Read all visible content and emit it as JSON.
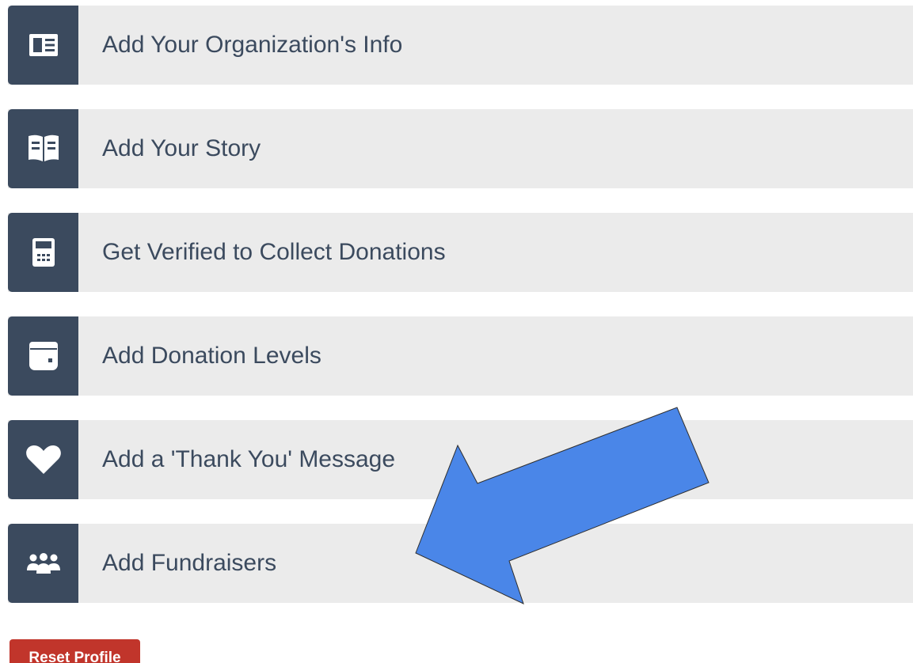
{
  "steps": [
    {
      "label": "Add Your Organization's Info",
      "icon": "id-card-icon"
    },
    {
      "label": "Add Your Story",
      "icon": "open-book-icon"
    },
    {
      "label": "Get Verified to Collect Donations",
      "icon": "calculator-icon"
    },
    {
      "label": "Add Donation Levels",
      "icon": "wallet-icon"
    },
    {
      "label": "Add a 'Thank You' Message",
      "icon": "heart-icon"
    },
    {
      "label": "Add Fundraisers",
      "icon": "users-icon"
    }
  ],
  "reset_button": {
    "label": "Reset Profile"
  },
  "colors": {
    "icon_background": "#3b4a5e",
    "row_background": "#ebebeb",
    "label_text": "#3b4a5e",
    "reset_button": "#c1352b",
    "arrow_fill": "#4a86e8"
  },
  "annotation": {
    "type": "arrow",
    "points_to": "Add Fundraisers"
  }
}
